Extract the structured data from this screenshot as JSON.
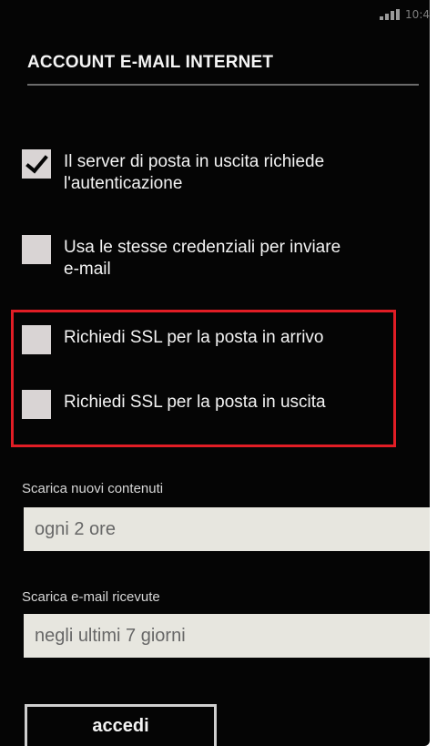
{
  "status_bar": {
    "time": "10:4"
  },
  "header": {
    "title": "ACCOUNT E-MAIL INTERNET"
  },
  "options": [
    {
      "label_line1": "Il server di posta in uscita richiede",
      "label_line2": "l'autenticazione",
      "checked": true
    },
    {
      "label_line1": "Usa le stesse credenziali per inviare",
      "label_line2": "e-mail",
      "checked": false
    },
    {
      "label_line1": "Richiedi SSL per la posta in arrivo",
      "checked": false
    },
    {
      "label_line1": "Richiedi SSL per la posta in uscita",
      "checked": false
    }
  ],
  "download_content": {
    "label": "Scarica nuovi contenuti",
    "value": "ogni 2 ore"
  },
  "download_email": {
    "label": "Scarica e-mail ricevute",
    "value": "negli ultimi 7 giorni"
  },
  "actions": {
    "signin_label": "accedi"
  },
  "colors": {
    "background": "#050505",
    "highlight": "#e11d25",
    "checkbox_fill": "#d9d4d4",
    "field_fill": "#e7e6df"
  }
}
